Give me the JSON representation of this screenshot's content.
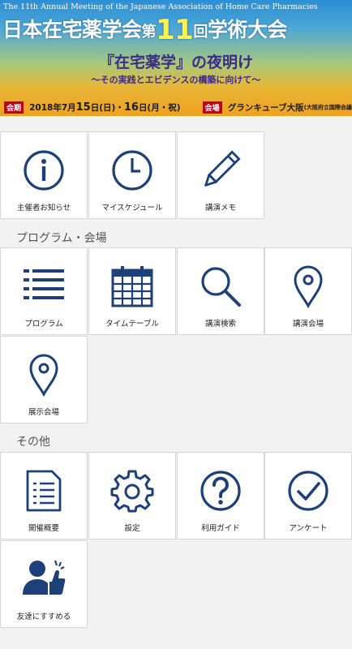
{
  "banner": {
    "subtitle": "The 11th Annual Meeting of the Japanese Association of Home Care Pharmacies",
    "title_pre": "日本在宅薬学会",
    "title_dai": "第",
    "title_num": "11",
    "title_kai": "回",
    "title_post": "学術大会",
    "catchphrase": "『在宅薬学』の夜明け",
    "catch_sub": "～その実践とエビデンスの構築に向けて～",
    "date_tag": "会期",
    "date_text_a": "2018年7月",
    "date_15": "15",
    "date_text_b": "日(日)・",
    "date_16": "16",
    "date_text_c": "日(月・祝)",
    "venue_tag": "会場",
    "venue_text": "グランキューブ大阪",
    "venue_note": "(大阪府立国際会議場)"
  },
  "top_tiles": [
    {
      "label": "主催者お知らせ",
      "icon": "info-icon"
    },
    {
      "label": "マイスケジュール",
      "icon": "clock-icon"
    },
    {
      "label": "講演メモ",
      "icon": "pencil-icon"
    }
  ],
  "section_program": "プログラム・会場",
  "program_tiles": [
    {
      "label": "プログラム",
      "icon": "list-icon"
    },
    {
      "label": "タイムテーブル",
      "icon": "calendar-icon"
    },
    {
      "label": "講演検索",
      "icon": "search-icon"
    },
    {
      "label": "講演会場",
      "icon": "map-pin-icon"
    },
    {
      "label": "展示会場",
      "icon": "map-pin-icon"
    }
  ],
  "section_other": "その他",
  "other_tiles": [
    {
      "label": "開催概要",
      "icon": "document-icon"
    },
    {
      "label": "設定",
      "icon": "gear-icon"
    },
    {
      "label": "利用ガイド",
      "icon": "question-icon"
    },
    {
      "label": "アンケート",
      "icon": "checkmark-icon"
    },
    {
      "label": "友達にすすめる",
      "icon": "thumbs-up-person-icon"
    }
  ],
  "colors": {
    "icon_blue": "#1d3f7a",
    "banner_red": "#c2001e",
    "background": "#f2f2f2"
  }
}
